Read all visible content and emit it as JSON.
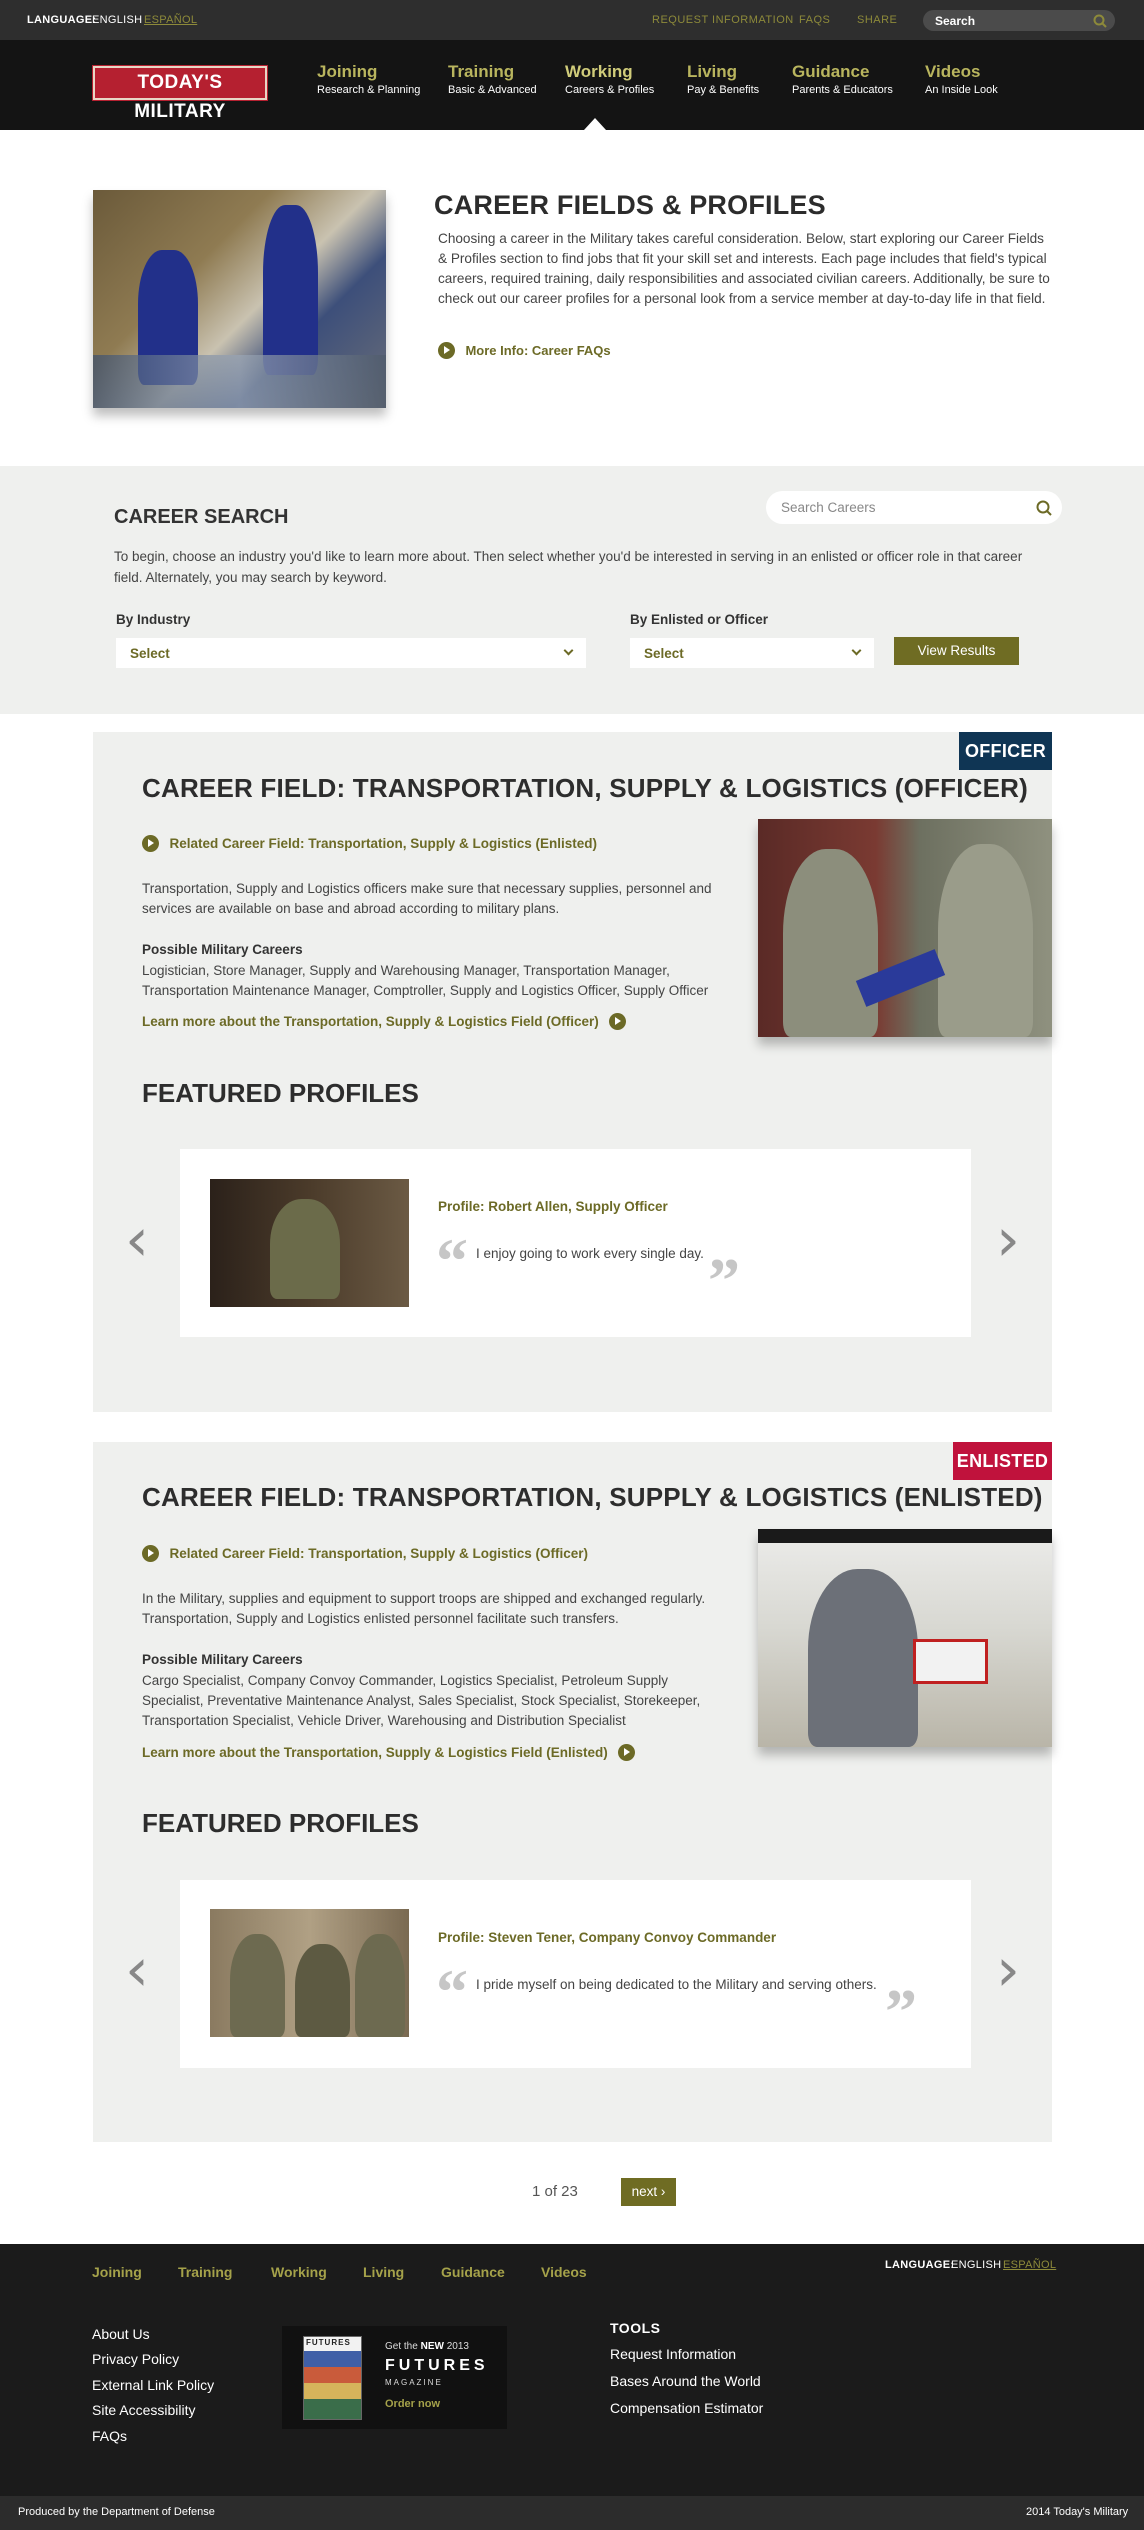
{
  "utility": {
    "language_label": "LANGUAGE:",
    "language_current": "ENGLISH",
    "language_alt": "ESPAÑOL",
    "links": [
      "REQUEST INFORMATION",
      "FAQS",
      "SHARE"
    ],
    "search_placeholder": "Search"
  },
  "brand": {
    "logo_text": "TODAY'S MILITARY"
  },
  "nav": [
    {
      "title": "Joining",
      "sub": "Research & Planning"
    },
    {
      "title": "Training",
      "sub": "Basic & Advanced"
    },
    {
      "title": "Working",
      "sub": "Careers & Profiles",
      "active": true
    },
    {
      "title": "Living",
      "sub": "Pay & Benefits"
    },
    {
      "title": "Guidance",
      "sub": "Parents & Educators"
    },
    {
      "title": "Videos",
      "sub": "An Inside Look"
    }
  ],
  "intro": {
    "title": "CAREER FIELDS & PROFILES",
    "body": "Choosing a career in the Military takes careful consideration. Below, start exploring our Career Fields & Profiles section to find jobs that fit your skill set and interests. Each page includes that field's typical careers, required training, daily responsibilities and associated civilian careers. Additionally, be sure to check out our career profiles for a personal look from a service member at day-to-day life in that field.",
    "more_link": "More Info: Career FAQs"
  },
  "career_search": {
    "title": "CAREER SEARCH",
    "placeholder": "Search Careers",
    "body": "To begin, choose an industry you'd like to learn more about. Then select whether you'd be interested in serving in an enlisted or officer role in that career field. Alternately, you may search by keyword.",
    "industry_label": "By Industry",
    "industry_value": "Select",
    "role_label": "By Enlisted or Officer",
    "role_value": "Select",
    "button": "View Results"
  },
  "fields": [
    {
      "badge": "OFFICER",
      "badge_color": "#0f3554",
      "title": "CAREER FIELD: TRANSPORTATION, SUPPLY & LOGISTICS (OFFICER)",
      "related": "Related Career Field: Transportation, Supply & Logistics (Enlisted)",
      "description": "Transportation, Supply and Logistics officers make sure that necessary supplies, personnel and services are available on base and abroad according to military plans.",
      "possible_heading": "Possible Military Careers",
      "possible_list": "Logistician, Store Manager, Supply and Warehousing Manager, Transportation Manager, Transportation Maintenance Manager, Comptroller, Supply and Logistics Officer, Supply Officer",
      "learn_more": "Learn more about the Transportation, Supply & Logistics Field (Officer)",
      "featured_title": "FEATURED PROFILES",
      "profile_name": "Profile: Robert Allen, Supply Officer",
      "quote": "I enjoy going to work every single day."
    },
    {
      "badge": "ENLISTED",
      "badge_color": "#c0123c",
      "title": "CAREER FIELD: TRANSPORTATION, SUPPLY & LOGISTICS (ENLISTED)",
      "related": "Related Career Field: Transportation, Supply & Logistics (Officer)",
      "description": "In the Military, supplies and equipment to support troops are shipped and exchanged regularly. Transportation, Supply and Logistics enlisted personnel facilitate such transfers.",
      "possible_heading": "Possible Military Careers",
      "possible_list": "Cargo Specialist, Company Convoy Commander, Logistics Specialist, Petroleum Supply Specialist, Preventative Maintenance Analyst, Sales Specialist, Stock Specialist, Storekeeper, Transportation Specialist, Vehicle Driver, Warehousing and Distribution Specialist",
      "learn_more": "Learn more about the Transportation, Supply & Logistics Field (Enlisted)",
      "featured_title": "FEATURED PROFILES",
      "profile_name": "Profile: Steven Tener, Company Convoy Commander",
      "quote": "I pride myself on being dedicated to the Military and serving others."
    }
  ],
  "pagination": {
    "text": "1 of 23",
    "next": "next ›"
  },
  "footer": {
    "nav": [
      "Joining",
      "Training",
      "Working",
      "Living",
      "Guidance",
      "Videos"
    ],
    "language_label": "LANGUAGE:",
    "language_current": "ENGLISH",
    "language_alt": "ESPAÑOL",
    "links": [
      "About Us",
      "Privacy Policy",
      "External Link Policy",
      "Site Accessibility",
      "FAQs"
    ],
    "promo": {
      "line1": "Get the",
      "new": "NEW",
      "year": "2013",
      "brand": "FUTURES",
      "sub": "MAGAZINE",
      "cta": "Order now",
      "cover_title": "FUTURES"
    },
    "tools_title": "TOOLS",
    "tools": [
      "Request Information",
      "Bases Around the World",
      "Compensation Estimator"
    ],
    "produced_by": "Produced by the Department of Defense",
    "copyright": "2014 Today's Military"
  }
}
